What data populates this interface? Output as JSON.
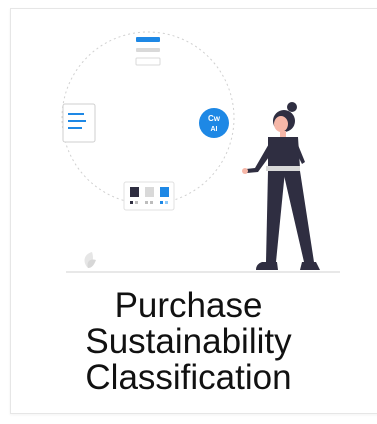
{
  "card": {
    "title_lines": [
      "Purchase",
      "Sustainability",
      "Classification"
    ],
    "badge": {
      "line1": "Cw",
      "line2": "AI"
    }
  },
  "colors": {
    "accent": "#1e88e5",
    "figure_dark": "#2f2e41",
    "skin": "#f6b7a8",
    "placeholder": "#d9d9d9"
  }
}
